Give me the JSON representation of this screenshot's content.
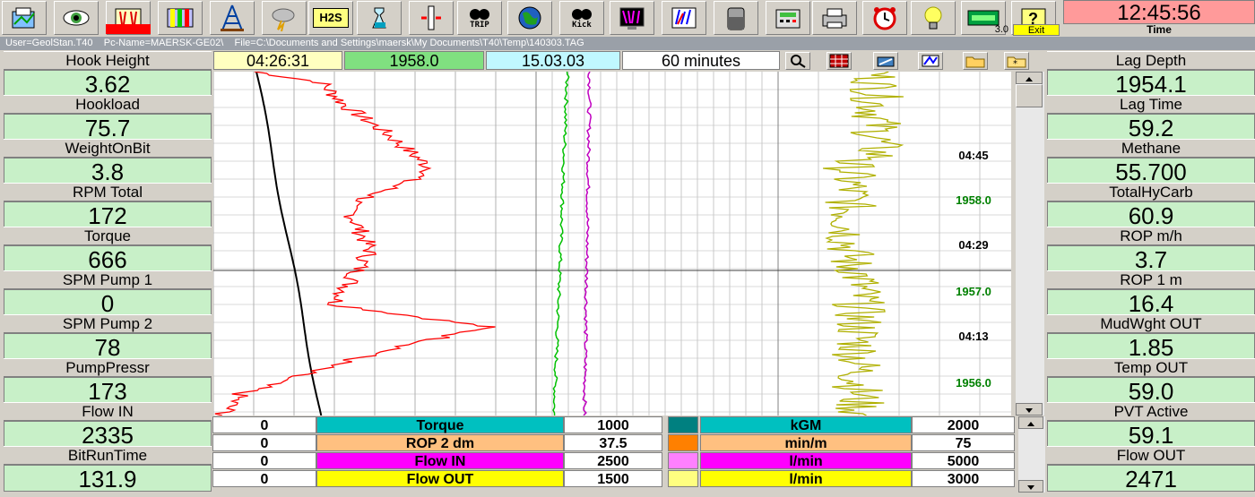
{
  "toolbar": {
    "icons": [
      "report-icon",
      "eye-icon",
      "chart-icon",
      "layers-icon",
      "rig-icon",
      "weather-icon",
      "h2s-icon",
      "flask-icon",
      "depth-icon",
      "trip-icon",
      "globe-icon",
      "kick-icon",
      "monitor-icon",
      "plot-icon",
      "tank-icon",
      "calculator-icon",
      "printer-icon",
      "alarm-clock-icon",
      "lightbulb-icon",
      "geostation-icon",
      "help-icon"
    ],
    "h2s_label": "H2S",
    "trip_label": "TRIP",
    "kick_label": "Kick",
    "version": "3.0",
    "exit_label": "Exit",
    "clock": "12:45:56",
    "clock_label": "Time"
  },
  "status": "User=GeolStan.T40    Pc-Name=MAERSK-GE02\\    File=C:\\Documents and Settings\\maersk\\My Documents\\T40\\Temp\\140303.TAG",
  "left_panel": [
    {
      "label": "Hook Height",
      "value": "3.62"
    },
    {
      "label": "Hookload",
      "value": "75.7"
    },
    {
      "label": "WeightOnBit",
      "value": "3.8"
    },
    {
      "label": "RPM Total",
      "value": "172"
    },
    {
      "label": "Torque",
      "value": "666"
    },
    {
      "label": "SPM Pump 1",
      "value": "0"
    },
    {
      "label": "SPM Pump 2",
      "value": "78"
    },
    {
      "label": "PumpPressr",
      "value": "173"
    },
    {
      "label": "Flow IN",
      "value": "2335"
    },
    {
      "label": "BitRunTime",
      "value": "131.9"
    }
  ],
  "right_panel": [
    {
      "label": "Lag Depth",
      "value": "1954.1"
    },
    {
      "label": "Lag Time",
      "value": "59.2"
    },
    {
      "label": "Methane",
      "value": "55.700"
    },
    {
      "label": "TotalHyCarb",
      "value": "60.9"
    },
    {
      "label": "ROP m/h",
      "value": "3.7"
    },
    {
      "label": "ROP 1 m",
      "value": "16.4"
    },
    {
      "label": "MudWght OUT",
      "value": "1.85"
    },
    {
      "label": "Temp OUT",
      "value": "59.0"
    },
    {
      "label": "PVT Active",
      "value": "59.1"
    },
    {
      "label": "Flow OUT",
      "value": "2471"
    }
  ],
  "header": {
    "time": "04:26:31",
    "depth": "1958.0",
    "date": "15.03.03",
    "span": "60 minutes"
  },
  "chart_markers": [
    {
      "text": "04:45",
      "color": "#000000"
    },
    {
      "text": "1958.0",
      "color": "#008000"
    },
    {
      "text": "04:29",
      "color": "#000000"
    },
    {
      "text": "1957.0",
      "color": "#008000"
    },
    {
      "text": "04:13",
      "color": "#000000"
    },
    {
      "text": "1956.0",
      "color": "#008000"
    }
  ],
  "legend": [
    {
      "min": "0",
      "name": "Torque",
      "max": "1000",
      "unit": "kGM",
      "max2": "2000",
      "color": "#00c0c0",
      "swatch": "#008080"
    },
    {
      "min": "0",
      "name": "ROP 2 dm",
      "max": "37.5",
      "unit": "min/m",
      "max2": "75",
      "color": "#ffc080",
      "swatch": "#ff8000"
    },
    {
      "min": "0",
      "name": "Flow IN",
      "max": "2500",
      "unit": "l/min",
      "max2": "5000",
      "color": "#ff00ff",
      "swatch": "#ff80ff"
    },
    {
      "min": "0",
      "name": "Flow OUT",
      "max": "1500",
      "unit": "l/min",
      "max2": "3000",
      "color": "#ffff00",
      "swatch": "#ffff80"
    }
  ]
}
